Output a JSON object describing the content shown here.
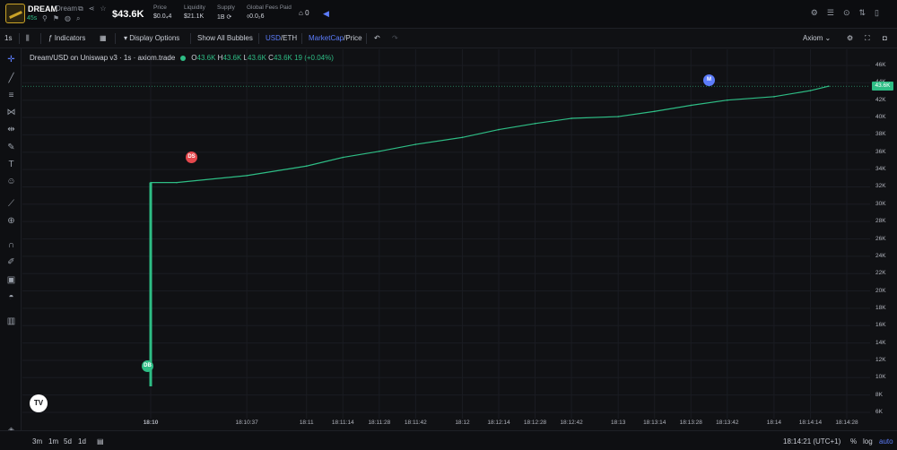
{
  "token": {
    "symbol": "DREAM",
    "name": "Dream",
    "age": "45s",
    "market_cap": "$43.6K",
    "stats": [
      {
        "label": "Price",
        "value": "$0.0₄4"
      },
      {
        "label": "Liquidity",
        "value": "$21.1K"
      },
      {
        "label": "Supply",
        "value": "1B"
      },
      {
        "label": "Global Fees Paid",
        "value": "0.0₂6"
      }
    ],
    "holders_count": "0"
  },
  "toolbar": {
    "interval": "1s",
    "indicators": "Indicators",
    "display_options": "Display Options",
    "show_bubbles": "Show All Bubbles",
    "usd": "USD",
    "slash1": "/",
    "eth": "ETH",
    "mcap": "MarketCap",
    "slash2": "/",
    "price": "Price",
    "platform": "Axiom"
  },
  "legend": {
    "title": "Dream/USD on Uniswap v3 · 1s · axiom.trade",
    "o_label": "O",
    "o": "43.6K",
    "h_label": "H",
    "h": "43.6K",
    "l_label": "L",
    "l": "43.6K",
    "c_label": "C",
    "c": "43.6K 19 (+0.04%)"
  },
  "price_tag": "43.6K",
  "bubbles": {
    "ds": "DS",
    "db": "DB",
    "m": "M"
  },
  "chart_data": {
    "type": "line",
    "y_ticks": [
      "46K",
      "44K",
      "42K",
      "40K",
      "38K",
      "36K",
      "34K",
      "32K",
      "30K",
      "28K",
      "26K",
      "24K",
      "22K",
      "20K",
      "18K",
      "16K",
      "14K",
      "12K",
      "10K",
      "8K",
      "6K"
    ],
    "x_ticks": [
      "18:10",
      "18:10:37",
      "18:11",
      "18:11:14",
      "18:11:28",
      "18:11:42",
      "18:12",
      "18:12:14",
      "18:12:28",
      "18:12:42",
      "18:13",
      "18:13:14",
      "18:13:28",
      "18:13:42",
      "18:14",
      "18:14:14",
      "18:14:28"
    ],
    "ylim": [
      6000,
      46000
    ],
    "series": [
      {
        "x": [
          "18:10",
          "18:10:10",
          "18:10:37",
          "18:11",
          "18:11:14",
          "18:11:28",
          "18:11:42",
          "18:12",
          "18:12:14",
          "18:12:28",
          "18:12:42",
          "18:13",
          "18:13:14",
          "18:13:28",
          "18:13:42",
          "18:14",
          "18:14:14",
          "18:14:21"
        ],
        "y": [
          9000,
          32500,
          33300,
          34400,
          35400,
          36100,
          36900,
          37700,
          38600,
          39300,
          39900,
          40100,
          40700,
          41400,
          42000,
          42400,
          43100,
          43600
        ]
      }
    ],
    "accent_color": "#2ebd85"
  },
  "bottom": {
    "ranges": [
      "3m",
      "1m",
      "5d",
      "1d"
    ],
    "clock": "18:14:21 (UTC+1)",
    "percent": "%",
    "log": "log",
    "auto": "auto"
  }
}
